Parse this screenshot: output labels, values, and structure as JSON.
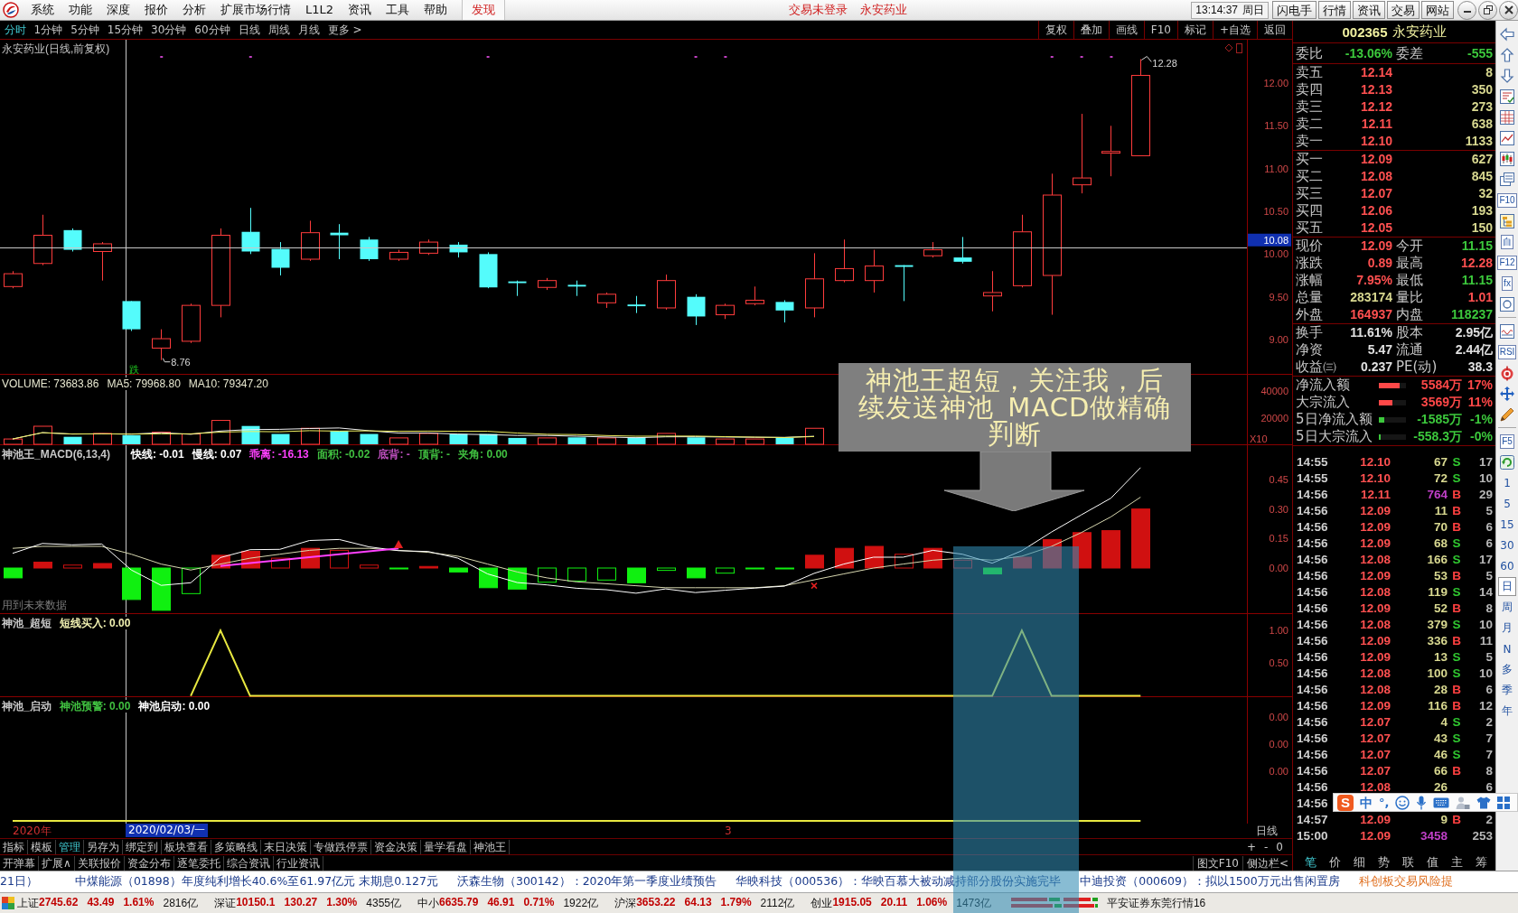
{
  "menu_bar": {
    "items": [
      "系统",
      "功能",
      "深度",
      "报价",
      "分析",
      "扩展市场行情",
      "L1L2",
      "资讯",
      "工具",
      "帮助"
    ],
    "discover": "发现",
    "notice": "交易未登录",
    "stock": "永安药业",
    "clock": "13:14:37",
    "weekday": "周日",
    "buttons": [
      "闪电手",
      "行情",
      "资讯",
      "交易",
      "网站"
    ]
  },
  "period_bar": {
    "items": [
      {
        "label": "分时",
        "selected": true
      },
      {
        "label": "1分钟",
        "selected": false
      },
      {
        "label": "5分钟",
        "selected": false
      },
      {
        "label": "15分钟",
        "selected": false
      },
      {
        "label": "30分钟",
        "selected": false
      },
      {
        "label": "60分钟",
        "selected": false
      },
      {
        "label": "日线",
        "selected": false
      },
      {
        "label": "周线",
        "selected": false
      },
      {
        "label": "月线",
        "selected": false
      },
      {
        "label": "更多 >",
        "selected": false
      }
    ],
    "actions": [
      "复权",
      "叠加",
      "画线",
      "F10",
      "标记",
      "+自选",
      "返回"
    ]
  },
  "chart": {
    "price_pane": {
      "title": "永安药业(日线,前复权)",
      "axis_labels": [
        "12.00",
        "11.50",
        "11.00",
        "10.50",
        "10.00",
        "9.50",
        "9.00"
      ],
      "crosshair_price": "10.08",
      "high_label": "12.28",
      "low_label": "8.76",
      "signal": "跌"
    },
    "volume_pane": {
      "legend": [
        "VOLUME: 73683.86",
        "MA5: 79968.80",
        "MA10: 79347.20"
      ],
      "axis_labels": [
        "40000",
        "20000"
      ],
      "scale": "X10"
    },
    "macd_pane": {
      "legend": [
        {
          "text": "神池王_MACD(6,13,4)",
          "color": "#c8c8c8"
        },
        {
          "text": "快线: -0.01",
          "color": "#ffffff"
        },
        {
          "text": "慢线: 0.07",
          "color": "#ffffff"
        },
        {
          "text": "乖离: -16.13",
          "color": "#ff40ff"
        },
        {
          "text": "面积: -0.02",
          "color": "#40c040"
        },
        {
          "text": "底背: -",
          "color": "#c050c0"
        },
        {
          "text": "顶背: -",
          "color": "#40c040"
        },
        {
          "text": "夹角: 0.00",
          "color": "#40c040"
        }
      ],
      "axis_labels": [
        "0.45",
        "0.30",
        "0.15",
        "0.00"
      ],
      "note": "用到未来数据"
    },
    "short_pane": {
      "legend": [
        {
          "text": "神池_超短",
          "color": "#c8c8c8"
        },
        {
          "text": "短线买入: 0.00",
          "color": "#f0f0b0"
        }
      ],
      "axis_labels": [
        "1.00",
        "0.50"
      ]
    },
    "launch_pane": {
      "legend": [
        {
          "text": "神池_启动",
          "color": "#c8c8c8"
        },
        {
          "text": "神池预警: 0.00",
          "color": "#40c040"
        },
        {
          "text": "神池启动: 0.00",
          "color": "#ffffff"
        }
      ],
      "axis_labels": [
        "0.00",
        "0.00",
        "0.00"
      ]
    },
    "x_axis": {
      "labels": [
        "2020年",
        "3"
      ],
      "crosshair_date": "2020/02/03/一",
      "period_label": "日线"
    },
    "zoom_controls": [
      "+",
      "-",
      "0"
    ]
  },
  "callout": {
    "text": "神池王超短，关注我，后续发送神池_MACD做精确判断"
  },
  "bottom_tabs": {
    "items": [
      {
        "label": "指标",
        "selected": false
      },
      {
        "label": "模板",
        "selected": false
      },
      {
        "label": "管理",
        "selected": true
      },
      {
        "label": "另存为",
        "selected": false
      },
      {
        "label": "绑定到",
        "selected": false
      },
      {
        "label": "板块查看",
        "selected": false
      },
      {
        "label": "多策略线",
        "selected": false
      },
      {
        "label": "末日决策",
        "selected": false
      },
      {
        "label": "专做跌停票",
        "selected": false
      },
      {
        "label": "资金决策",
        "selected": false
      },
      {
        "label": "量学看盘",
        "selected": false
      },
      {
        "label": "神池王",
        "selected": false
      }
    ]
  },
  "info_tabs": {
    "items": [
      "开弹幕",
      "扩展∧",
      "关联报价",
      "资金分布",
      "逐笔委托",
      "综合资讯",
      "行业资讯"
    ],
    "side_links": [
      "图文F10",
      "侧边栏<"
    ]
  },
  "quote_panel": {
    "code": "002365",
    "name": "永安药业",
    "summary": [
      {
        "label": "委比",
        "value": "-13.06%",
        "color": "#3cc83c"
      },
      {
        "label": "委差",
        "value": "-555",
        "color": "#3cc83c"
      }
    ],
    "asks": [
      {
        "label": "卖五",
        "price": "12.14",
        "volume": "8"
      },
      {
        "label": "卖四",
        "price": "12.13",
        "volume": "350"
      },
      {
        "label": "卖三",
        "price": "12.12",
        "volume": "273"
      },
      {
        "label": "卖二",
        "price": "12.11",
        "volume": "638"
      },
      {
        "label": "卖一",
        "price": "12.10",
        "volume": "1133"
      }
    ],
    "bids": [
      {
        "label": "买一",
        "price": "12.09",
        "volume": "627"
      },
      {
        "label": "买二",
        "price": "12.08",
        "volume": "845"
      },
      {
        "label": "买三",
        "price": "12.07",
        "volume": "32"
      },
      {
        "label": "买四",
        "price": "12.06",
        "volume": "193"
      },
      {
        "label": "买五",
        "price": "12.05",
        "volume": "150"
      }
    ],
    "stats": [
      {
        "label": "现价",
        "value": "12.09",
        "color": "#ff5050"
      },
      {
        "label": "今开",
        "value": "11.15",
        "color": "#3cc83c"
      },
      {
        "label": "涨跌",
        "value": "0.89",
        "color": "#ff5050"
      },
      {
        "label": "最高",
        "value": "12.28",
        "color": "#ff5050"
      },
      {
        "label": "涨幅",
        "value": "7.95%",
        "color": "#ff5050"
      },
      {
        "label": "最低",
        "value": "11.15",
        "color": "#3cc83c"
      },
      {
        "label": "总量",
        "value": "283174",
        "color": "#d8d890"
      },
      {
        "label": "量比",
        "value": "1.01",
        "color": "#ff5050"
      },
      {
        "label": "外盘",
        "value": "164937",
        "color": "#ff5050"
      },
      {
        "label": "内盘",
        "value": "118237",
        "color": "#3cc83c"
      }
    ],
    "fundamentals": [
      {
        "label": "换手",
        "value": "11.61%"
      },
      {
        "label": "股本",
        "value": "2.95亿"
      },
      {
        "label": "净资",
        "value": "5.47"
      },
      {
        "label": "流通",
        "value": "2.44亿"
      },
      {
        "label": "收益㈢",
        "value": "0.237"
      },
      {
        "label": "PE(动)",
        "value": "38.3"
      }
    ],
    "fund_flow": [
      {
        "label": "净流入额",
        "level": 0.77,
        "amount": "5584万",
        "percent": "17%",
        "color": "#ff4848"
      },
      {
        "label": "大宗流入",
        "level": 0.5,
        "amount": "3569万",
        "percent": "11%",
        "color": "#ff4848"
      },
      {
        "label": "5日净流入额",
        "level": 0.2,
        "amount": "-1585万",
        "percent": "-1%",
        "color": "#3cc83c"
      },
      {
        "label": "5日大宗流入",
        "level": 0.07,
        "amount": "-558.3万",
        "percent": "-0%",
        "color": "#3cc83c"
      }
    ],
    "trades": [
      {
        "time": "14:55",
        "price": "12.10",
        "volume": "67",
        "color": "#d8d890",
        "side": "S",
        "kind": "sell",
        "count": "17"
      },
      {
        "time": "14:55",
        "price": "12.10",
        "volume": "72",
        "color": "#d8d890",
        "side": "S",
        "kind": "sell",
        "count": "10"
      },
      {
        "time": "14:56",
        "price": "12.11",
        "volume": "764",
        "color": "#c040c8",
        "side": "B",
        "kind": "buy",
        "count": "29"
      },
      {
        "time": "14:56",
        "price": "12.09",
        "volume": "11",
        "color": "#d8d890",
        "side": "B",
        "kind": "buy",
        "count": "5"
      },
      {
        "time": "14:56",
        "price": "12.09",
        "volume": "70",
        "color": "#d8d890",
        "side": "B",
        "kind": "buy",
        "count": "6"
      },
      {
        "time": "14:56",
        "price": "12.09",
        "volume": "68",
        "color": "#d8d890",
        "side": "S",
        "kind": "sell",
        "count": "6"
      },
      {
        "time": "14:56",
        "price": "12.08",
        "volume": "166",
        "color": "#d8d890",
        "side": "S",
        "kind": "sell",
        "count": "17"
      },
      {
        "time": "14:56",
        "price": "12.09",
        "volume": "53",
        "color": "#d8d890",
        "side": "B",
        "kind": "buy",
        "count": "5"
      },
      {
        "time": "14:56",
        "price": "12.08",
        "volume": "119",
        "color": "#d8d890",
        "side": "S",
        "kind": "sell",
        "count": "14"
      },
      {
        "time": "14:56",
        "price": "12.09",
        "volume": "52",
        "color": "#d8d890",
        "side": "B",
        "kind": "buy",
        "count": "8"
      },
      {
        "time": "14:56",
        "price": "12.08",
        "volume": "379",
        "color": "#d8d890",
        "side": "S",
        "kind": "sell",
        "count": "10"
      },
      {
        "time": "14:56",
        "price": "12.09",
        "volume": "336",
        "color": "#d8d890",
        "side": "B",
        "kind": "buy",
        "count": "11"
      },
      {
        "time": "14:56",
        "price": "12.09",
        "volume": "13",
        "color": "#d8d890",
        "side": "S",
        "kind": "sell",
        "count": "5"
      },
      {
        "time": "14:56",
        "price": "12.08",
        "volume": "100",
        "color": "#d8d890",
        "side": "S",
        "kind": "sell",
        "count": "10"
      },
      {
        "time": "14:56",
        "price": "12.08",
        "volume": "28",
        "color": "#d8d890",
        "side": "B",
        "kind": "buy",
        "count": "6"
      },
      {
        "time": "14:56",
        "price": "12.09",
        "volume": "116",
        "color": "#d8d890",
        "side": "B",
        "kind": "buy",
        "count": "12"
      },
      {
        "time": "14:56",
        "price": "12.07",
        "volume": "4",
        "color": "#d8d890",
        "side": "S",
        "kind": "sell",
        "count": "2"
      },
      {
        "time": "14:56",
        "price": "12.07",
        "volume": "43",
        "color": "#d8d890",
        "side": "S",
        "kind": "sell",
        "count": "7"
      },
      {
        "time": "14:56",
        "price": "12.07",
        "volume": "46",
        "color": "#d8d890",
        "side": "S",
        "kind": "sell",
        "count": "7"
      },
      {
        "time": "14:56",
        "price": "12.07",
        "volume": "66",
        "color": "#d8d890",
        "side": "B",
        "kind": "buy",
        "count": "8"
      },
      {
        "time": "14:56",
        "price": "12.08",
        "volume": "26",
        "color": "#d8d890",
        "count": "6"
      },
      {
        "time": "14:56"
      },
      {
        "time": "14:57",
        "price": "12.09",
        "volume": "9",
        "color": "#d8d890",
        "side": "B",
        "kind": "buy",
        "count": "2"
      },
      {
        "time": "15:00",
        "price": "12.09",
        "volume": "3458",
        "color": "#c040c8",
        "count": "253"
      }
    ],
    "tabs": [
      {
        "label": "笔",
        "selected": true
      },
      {
        "label": "价",
        "selected": false
      },
      {
        "label": "细",
        "selected": false
      },
      {
        "label": "势",
        "selected": false
      },
      {
        "label": "联",
        "selected": false
      },
      {
        "label": "值",
        "selected": false
      },
      {
        "label": "主",
        "selected": false
      },
      {
        "label": "筹",
        "selected": false
      }
    ]
  },
  "side_toolbar": {
    "tools": [
      {
        "kind": "icon"
      },
      {
        "kind": "icon"
      },
      {
        "kind": "icon"
      },
      {
        "kind": "icon"
      },
      {
        "kind": "icon"
      },
      {
        "kind": "icon"
      },
      {
        "kind": "icon"
      },
      {
        "kind": "icon"
      },
      {
        "kind": "label",
        "text": "F10"
      },
      {
        "kind": "icon"
      },
      {
        "kind": "label",
        "text": "自"
      },
      {
        "kind": "label",
        "text": "F12"
      },
      {
        "kind": "label",
        "text": "fx"
      },
      {
        "kind": "icon"
      },
      {
        "kind": "separator"
      },
      {
        "kind": "icon"
      },
      {
        "kind": "label",
        "text": "RSI"
      },
      {
        "kind": "icon"
      },
      {
        "kind": "icon"
      },
      {
        "kind": "icon"
      },
      {
        "kind": "separator"
      },
      {
        "kind": "label",
        "text": "F5"
      },
      {
        "kind": "icon"
      }
    ],
    "periods": [
      {
        "label": "1",
        "selected": false
      },
      {
        "label": "5",
        "selected": false
      },
      {
        "label": "15",
        "selected": false
      },
      {
        "label": "30",
        "selected": false
      },
      {
        "label": "60",
        "selected": false
      },
      {
        "label": "日",
        "selected": true
      },
      {
        "label": "周",
        "selected": false
      },
      {
        "label": "月",
        "selected": false
      },
      {
        "label": "N",
        "selected": false
      },
      {
        "label": "多",
        "selected": false
      },
      {
        "label": "季",
        "selected": false
      },
      {
        "label": "年",
        "selected": false
      }
    ]
  },
  "news_ticker": {
    "items": [
      "21日）",
      "中煤能源（01898）年度纯利增长40.6%至61.97亿元 末期息0.127元",
      "沃森生物（300142）：2020年第一季度业绩预告",
      "华映科技（000536）：华映百慕大被动减持部分股份实施完毕",
      "中迪投资（000609）：拟以1500万元出售闲置房"
    ],
    "alert": "科创板交易风险提"
  },
  "status_bar": {
    "indices": [
      {
        "name": "上证",
        "value": "2745.62",
        "change": "43.49",
        "percent": "1.61%",
        "amount": "2816亿"
      },
      {
        "name": "深证",
        "value": "10150.1",
        "change": "130.27",
        "percent": "1.30%",
        "amount": "4355亿"
      },
      {
        "name": "中小",
        "value": "6635.79",
        "change": "46.91",
        "percent": "0.71%",
        "amount": "1922亿"
      },
      {
        "name": "沪深",
        "value": "3653.22",
        "change": "64.13",
        "percent": "1.79%",
        "amount": "2112亿"
      },
      {
        "name": "创业",
        "value": "1915.05",
        "change": "20.11",
        "percent": "1.06%",
        "amount": "1473亿"
      }
    ],
    "broker": "平安证券东莞行情16"
  },
  "ime_bar": {
    "logo": "S",
    "mode": "中",
    "punctuation": "°,"
  }
}
